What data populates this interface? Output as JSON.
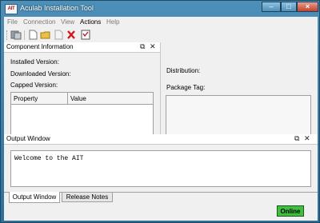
{
  "window": {
    "title": "Aculab Installation Tool",
    "logo_text": "AIT"
  },
  "menus": [
    "File",
    "Connection",
    "View",
    "Actions",
    "Help"
  ],
  "component_panel": {
    "title": "Component Information",
    "installed_label": "Installed Version:",
    "downloaded_label": "Downloaded Version:",
    "capped_label": "Capped Version:",
    "columns": [
      "Property",
      "Value"
    ]
  },
  "right_panel": {
    "distribution_label": "Distribution:",
    "package_tag_label": "Package Tag:"
  },
  "output_panel": {
    "title": "Output Window",
    "text": "Welcome to the AIT"
  },
  "tabs": [
    "Output Window",
    "Release Notes"
  ],
  "status": {
    "text": "Online",
    "color": "#3fbf3f"
  },
  "icons": [
    "restore-icon",
    "close-icon"
  ]
}
